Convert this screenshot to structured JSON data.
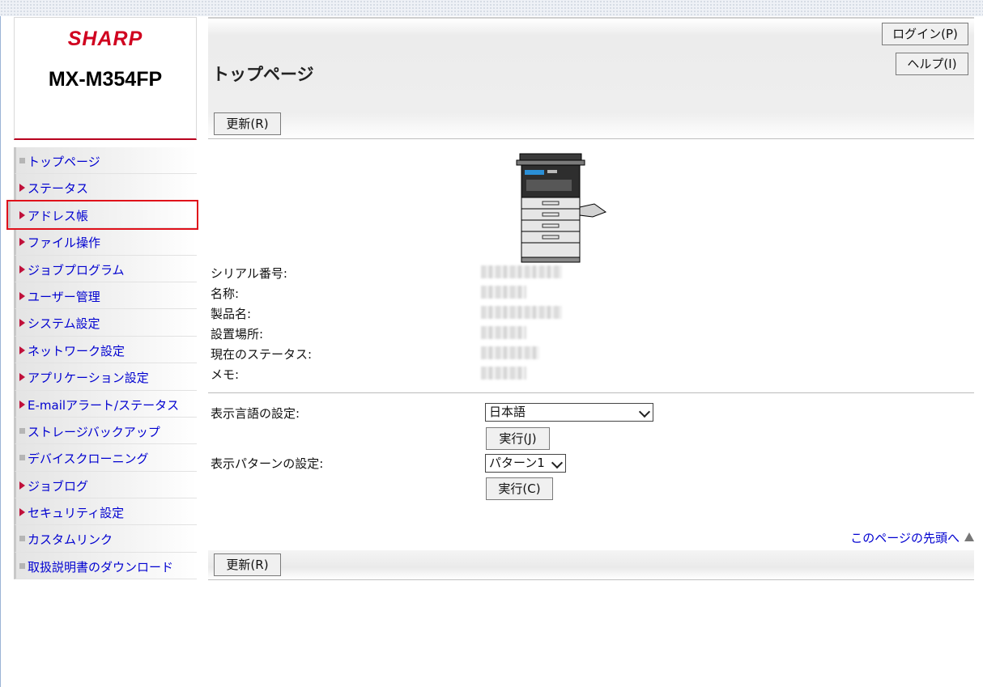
{
  "brand": "SHARP",
  "model": "MX-M354FP",
  "header": {
    "title": "トップページ",
    "login_label": "ログイン(P)",
    "help_label": "ヘルプ(I)",
    "refresh_label": "更新(R)"
  },
  "nav": {
    "items": [
      {
        "label": "トップページ"
      },
      {
        "label": "ステータス"
      },
      {
        "label": "アドレス帳"
      },
      {
        "label": "ファイル操作"
      },
      {
        "label": "ジョブプログラム"
      },
      {
        "label": "ユーザー管理"
      },
      {
        "label": "システム設定"
      },
      {
        "label": "ネットワーク設定"
      },
      {
        "label": "アプリケーション設定"
      },
      {
        "label": "E-mailアラート/ステータス"
      },
      {
        "label": "ストレージバックアップ"
      },
      {
        "label": "デバイスクローニング"
      },
      {
        "label": "ジョブログ"
      },
      {
        "label": "セキュリティ設定"
      },
      {
        "label": "カスタムリンク"
      },
      {
        "label": "取扱説明書のダウンロード"
      }
    ]
  },
  "info": {
    "serial_label": "シリアル番号:",
    "name_label": "名称:",
    "product_label": "製品名:",
    "location_label": "設置場所:",
    "status_label": "現在のステータス:",
    "memo_label": "メモ:"
  },
  "settings": {
    "language_label": "表示言語の設定:",
    "language_value": "日本語",
    "execute_j_label": "実行(J)",
    "pattern_label": "表示パターンの設定:",
    "pattern_value": "パターン1",
    "execute_c_label": "実行(C)"
  },
  "footer": {
    "to_top_label": "このページの先頭へ",
    "refresh_label": "更新(R)"
  },
  "colors": {
    "brand_red": "#d0001f",
    "link_blue": "#0000d0",
    "highlight_red": "#e0101a"
  }
}
